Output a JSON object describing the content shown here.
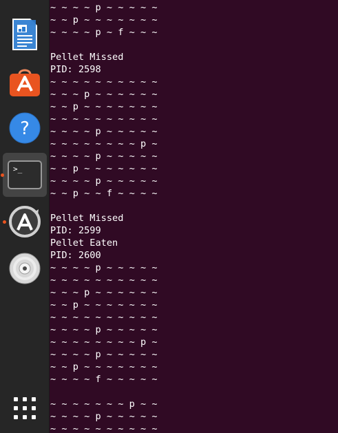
{
  "dock": {
    "items": [
      {
        "name": "writer-icon"
      },
      {
        "name": "software-store-icon"
      },
      {
        "name": "help-icon"
      },
      {
        "name": "terminal-icon",
        "prompt": ">_"
      },
      {
        "name": "software-updater-icon"
      },
      {
        "name": "optical-disc-icon"
      },
      {
        "name": "show-apps-icon"
      }
    ]
  },
  "terminal": {
    "lines": [
      "~ ~ ~ ~ p ~ ~ ~ ~ ~",
      "~ ~ p ~ ~ ~ ~ ~ ~ ~",
      "~ ~ ~ ~ p ~ f ~ ~ ~",
      "",
      "Pellet Missed",
      "PID: 2598",
      "~ ~ ~ ~ ~ ~ ~ ~ ~ ~",
      "~ ~ ~ p ~ ~ ~ ~ ~ ~",
      "~ ~ p ~ ~ ~ ~ ~ ~ ~",
      "~ ~ ~ ~ ~ ~ ~ ~ ~ ~",
      "~ ~ ~ ~ p ~ ~ ~ ~ ~",
      "~ ~ ~ ~ ~ ~ ~ ~ p ~",
      "~ ~ ~ ~ p ~ ~ ~ ~ ~",
      "~ ~ p ~ ~ ~ ~ ~ ~ ~",
      "~ ~ ~ ~ p ~ ~ ~ ~ ~",
      "~ ~ p ~ ~ f ~ ~ ~ ~",
      "",
      "Pellet Missed",
      "PID: 2599",
      "Pellet Eaten",
      "PID: 2600",
      "~ ~ ~ ~ p ~ ~ ~ ~ ~",
      "~ ~ ~ ~ ~ ~ ~ ~ ~ ~",
      "~ ~ ~ p ~ ~ ~ ~ ~ ~",
      "~ ~ p ~ ~ ~ ~ ~ ~ ~",
      "~ ~ ~ ~ ~ ~ ~ ~ ~ ~",
      "~ ~ ~ ~ p ~ ~ ~ ~ ~",
      "~ ~ ~ ~ ~ ~ ~ ~ p ~",
      "~ ~ ~ ~ p ~ ~ ~ ~ ~",
      "~ ~ p ~ ~ ~ ~ ~ ~ ~",
      "~ ~ ~ ~ f ~ ~ ~ ~ ~",
      "",
      "~ ~ ~ ~ ~ ~ ~ p ~ ~",
      "~ ~ ~ ~ p ~ ~ ~ ~ ~",
      "~ ~ ~ ~ ~ ~ ~ ~ ~ ~"
    ]
  }
}
